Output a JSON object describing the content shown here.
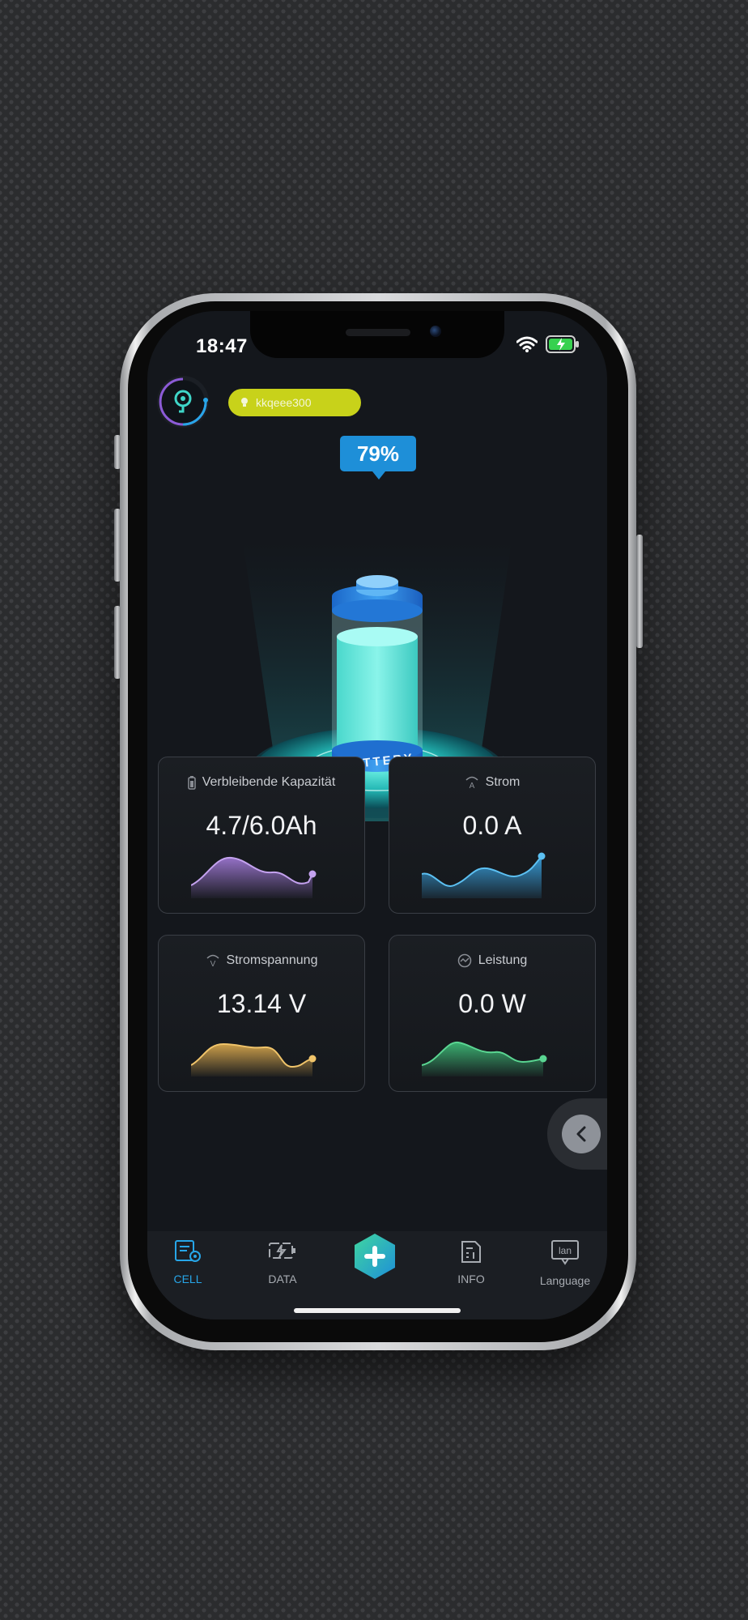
{
  "status_bar": {
    "time": "18:47"
  },
  "header": {
    "device_name": "kkqeee300"
  },
  "battery": {
    "percent_label": "79%",
    "percent": 79,
    "label": "BATTERY"
  },
  "cards": [
    {
      "title": "Verbleibende Kapazität",
      "value": "4.7/6.0Ah",
      "color": "#a27ad8"
    },
    {
      "title": "Strom",
      "value": "0.0  A",
      "color": "#3aa6e6"
    },
    {
      "title": "Stromspannung",
      "value": "13.14  V",
      "color": "#e0ad4f"
    },
    {
      "title": "Leistung",
      "value": "0.0 W",
      "color": "#3fc07a"
    }
  ],
  "tabbar": {
    "items": [
      {
        "label": "CELL",
        "icon": "cell-icon",
        "active": true
      },
      {
        "label": "DATA",
        "icon": "data-icon",
        "active": false
      },
      {
        "label": "",
        "icon": "plus-icon",
        "active": false
      },
      {
        "label": "INFO",
        "icon": "info-icon",
        "active": false
      },
      {
        "label": "Language",
        "icon": "language-icon",
        "active": false
      }
    ],
    "language_icon_text": "lan"
  },
  "colors": {
    "accent": "#27a6e8",
    "pill": "#c8d21a",
    "battery_teal": "#3fd6c8"
  }
}
